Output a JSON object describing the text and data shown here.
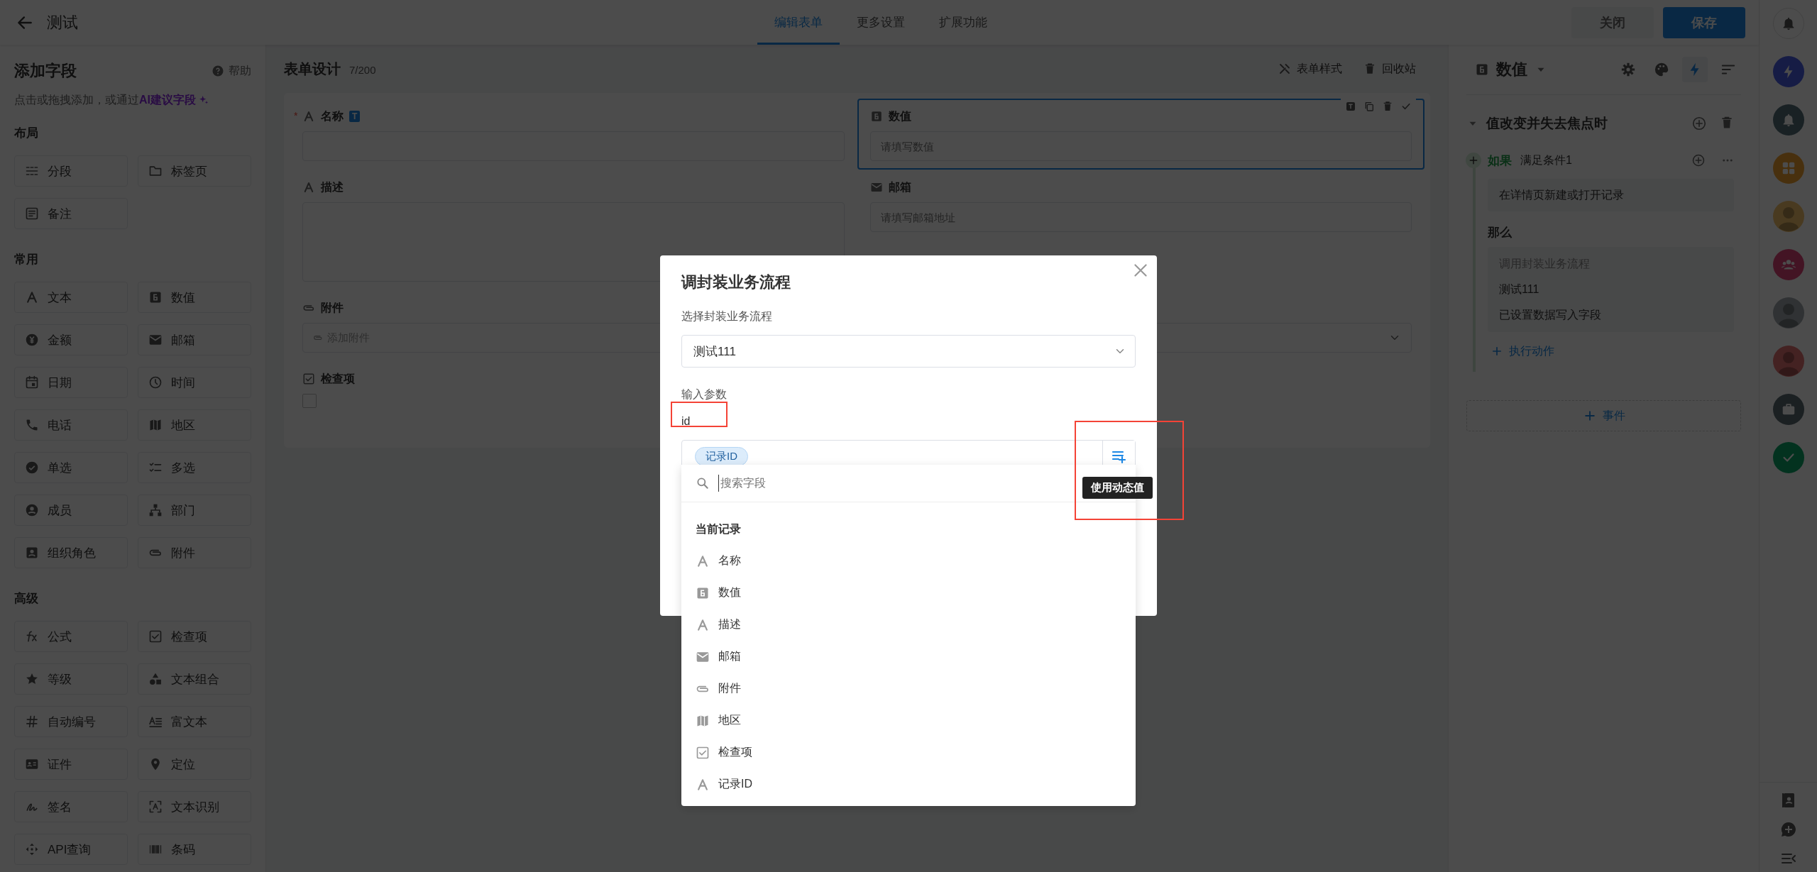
{
  "header": {
    "title": "测试",
    "tabs": [
      {
        "label": "编辑表单",
        "selected": true
      },
      {
        "label": "更多设置",
        "selected": false
      },
      {
        "label": "扩展功能",
        "selected": false
      }
    ],
    "buttons": [
      {
        "label": "关闭",
        "kind": "secondary"
      },
      {
        "label": "保存",
        "kind": "primary"
      }
    ]
  },
  "field_palette": {
    "title": "添加字段",
    "help": "帮助",
    "hint": "点击或拖拽添加，或通过",
    "ai_link": "AI建议字段",
    "sections": [
      {
        "title": "布局",
        "items": [
          "分段",
          "标签页",
          "备注"
        ]
      },
      {
        "title": "常用",
        "items": [
          "文本",
          "数值",
          "金额",
          "邮箱",
          "日期",
          "时间",
          "电话",
          "地区",
          "单选",
          "多选",
          "成员",
          "部门",
          "组织角色",
          "附件"
        ]
      },
      {
        "title": "高级",
        "items": [
          "公式",
          "检查项",
          "等级",
          "文本组合",
          "自动编号",
          "富文本",
          "证件",
          "定位",
          "签名",
          "文本识别",
          "API查询",
          "条码"
        ]
      }
    ]
  },
  "form_design": {
    "title": "表单设计",
    "count": "7/200",
    "actions": [
      "表单样式",
      "回收站"
    ],
    "fields": [
      {
        "kind": "text",
        "label": "名称",
        "badge": "T",
        "required_mark": "*",
        "selected": false
      },
      {
        "kind": "number",
        "label": "数值",
        "placeholder": "请填写数值",
        "selected": true
      },
      {
        "kind": "textarea",
        "label": "描述",
        "selected": false
      },
      {
        "kind": "email",
        "label": "邮箱",
        "placeholder": "请填写邮箱地址",
        "selected": false
      },
      {
        "kind": "attachment",
        "label": "附件",
        "placeholder": "添加附件",
        "selected": false
      },
      {
        "kind": "select",
        "selected": false
      },
      {
        "kind": "checkbox",
        "label": "检查项",
        "checked": false,
        "selected": false
      }
    ]
  },
  "rule_panel": {
    "field": "数值",
    "tools": [
      {
        "selected": false
      },
      {
        "selected": false
      },
      {
        "selected": true
      },
      {
        "selected": false
      }
    ],
    "event": {
      "title": "值改变并失去焦点时",
      "expanded": true,
      "condition": {
        "keyword": "如果",
        "text": "满足条件1",
        "trigger": "在详情页新建或打开记录"
      },
      "then": "那么",
      "action": {
        "type": "调用封装业务流程",
        "lines": [
          "测试111",
          "已设置数据写入字段"
        ]
      },
      "add_action": "执行动作"
    },
    "add_event": "事件"
  },
  "side_strip": {
    "items": [
      {
        "kind": "app"
      },
      {
        "kind": "app"
      },
      {
        "kind": "app"
      },
      {
        "kind": "avatar"
      },
      {
        "kind": "app"
      },
      {
        "kind": "avatar"
      },
      {
        "kind": "avatar"
      },
      {
        "kind": "app"
      },
      {
        "kind": "app"
      }
    ]
  },
  "modal": {
    "title": "调封装业务流程",
    "select_label": "选择封装业务流程",
    "select_value": "测试111",
    "params_label": "输入参数",
    "param_name": "id",
    "param_chip": "记录ID",
    "tooltip": "使用动态值",
    "dropdown": {
      "search_placeholder": "搜索字段",
      "group": "当前记录",
      "items": [
        {
          "label": "名称",
          "kind": "text"
        },
        {
          "label": "数值",
          "kind": "number"
        },
        {
          "label": "描述",
          "kind": "text"
        },
        {
          "label": "邮箱",
          "kind": "email"
        },
        {
          "label": "附件",
          "kind": "attachment"
        },
        {
          "label": "地区",
          "kind": "region"
        },
        {
          "label": "检查项",
          "kind": "checkbox"
        },
        {
          "label": "记录ID",
          "kind": "text"
        }
      ]
    }
  }
}
